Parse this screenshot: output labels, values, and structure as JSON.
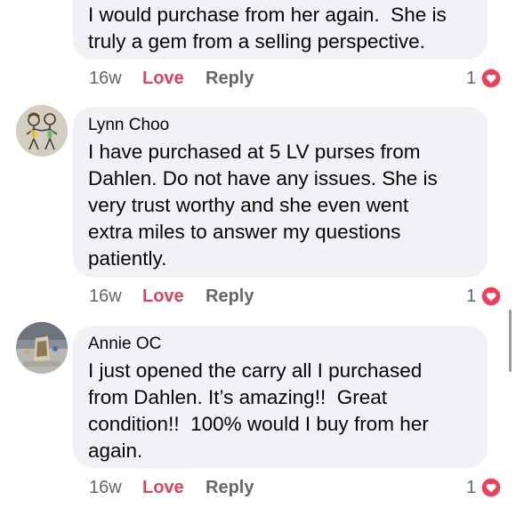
{
  "colors": {
    "bubble": "#f0f2f5",
    "love_reaction": "#e4405f",
    "meta_text": "#65676b",
    "heart": "#f33e58"
  },
  "comments": [
    {
      "author": "",
      "text": "I would purchase from her again.  She is\ntruly a gem from a selling perspective.",
      "time": "16w",
      "love_label": "Love",
      "reply_label": "Reply",
      "reaction_count": "1",
      "reaction_icon": "heart-icon"
    },
    {
      "author": "Lynn Choo",
      "avatar_icon": "couple-drawing-avatar",
      "text": "I have purchased at 5 LV purses from\nDahlen. Do not have any issues. She is\nvery trust worthy and she even went\nextra miles to answer my questions\npatiently.",
      "time": "16w",
      "love_label": "Love",
      "reply_label": "Reply",
      "reaction_count": "1",
      "reaction_icon": "heart-icon"
    },
    {
      "author": "Annie OC",
      "avatar_icon": "photo-avatar",
      "text": "I just opened the carry all I purchased\nfrom Dahlen. It’s amazing!!  Great\ncondition!!  100% would I buy from her\nagain.",
      "time": "16w",
      "love_label": "Love",
      "reply_label": "Reply",
      "reaction_count": "1",
      "reaction_icon": "heart-icon"
    }
  ]
}
